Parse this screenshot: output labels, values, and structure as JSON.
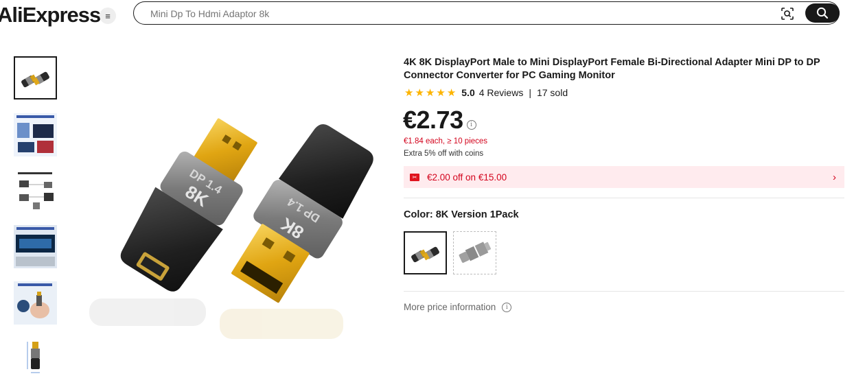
{
  "header": {
    "logo_text": "AliExpress",
    "menu_icon": "≡",
    "search_placeholder": "Mini Dp To Hdmi Adaptor 8k"
  },
  "product": {
    "title": "4K 8K DisplayPort Male to Mini DisplayPort Female Bi-Directional Adapter Mini DP to DP Connector Converter for PC Gaming Monitor",
    "rating_score": "5.0",
    "rating_stars": 5,
    "reviews": "4 Reviews",
    "sold": "17 sold",
    "price": "€2.73",
    "bulk_price": "€1.84 each, ≥ 10 pieces",
    "coins_note": "Extra 5% off with coins",
    "coupon": "€2.00 off on €15.00",
    "color_label": "Color: 8K Version 1Pack",
    "more_price_info": "More price information",
    "connector_badge_text": "DP 1.4",
    "connector_badge_big": "8K"
  },
  "thumbnails": [
    {
      "name": "thumb-adapter-pair",
      "active": true
    },
    {
      "name": "thumb-8k-resolution",
      "active": false
    },
    {
      "name": "thumb-compatibility",
      "active": false
    },
    {
      "name": "thumb-large-screen",
      "active": false
    },
    {
      "name": "thumb-small-portable",
      "active": false
    },
    {
      "name": "thumb-dimensions",
      "active": false
    }
  ],
  "colors": {
    "accent_red": "#d3031c",
    "star_yellow": "#fdb400",
    "coupon_bg": "#ffebee",
    "text_dark": "#191919"
  }
}
